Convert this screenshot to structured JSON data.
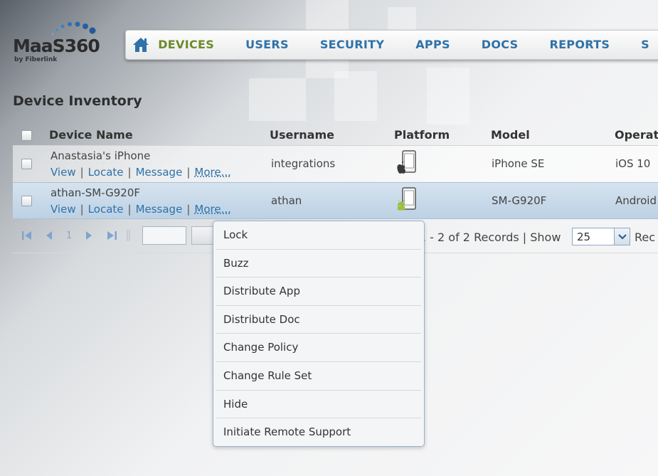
{
  "logo": {
    "word": "MaaS360",
    "byline": "by Fiberlink"
  },
  "nav": {
    "tabs": [
      "DEVICES",
      "USERS",
      "SECURITY",
      "APPS",
      "DOCS",
      "REPORTS",
      "S"
    ],
    "active": "DEVICES"
  },
  "page": {
    "title": "Device Inventory"
  },
  "table": {
    "headers": {
      "device_name": "Device Name",
      "username": "Username",
      "platform": "Platform",
      "model": "Model",
      "os": "Operat"
    },
    "row_actions": {
      "view": "View",
      "locate": "Locate",
      "message": "Message",
      "more": "More..."
    },
    "action_sep": "|",
    "rows": [
      {
        "device_name": "Anastasia's iPhone",
        "username": "integrations",
        "platform_icon": "ios-phone-icon",
        "model": "iPhone SE",
        "os": "iOS 10"
      },
      {
        "device_name": "athan-SM-G920F",
        "username": "athan",
        "platform_icon": "android-phone-icon",
        "model": "SM-G920F",
        "os": "Android"
      }
    ]
  },
  "pager": {
    "page": "1",
    "records": ". - 2 of 2 Records | Show",
    "show_value": "25",
    "records_suffix": "Rec"
  },
  "more_menu": {
    "items": [
      "Lock",
      "Buzz",
      "Distribute App",
      "Distribute Doc",
      "Change Policy",
      "Change Rule Set",
      "Hide",
      "Initiate Remote Support"
    ]
  },
  "colors": {
    "nav_link": "#2f72a8",
    "nav_active": "#6d8a2a",
    "selected_row": "#c6d8ea"
  }
}
